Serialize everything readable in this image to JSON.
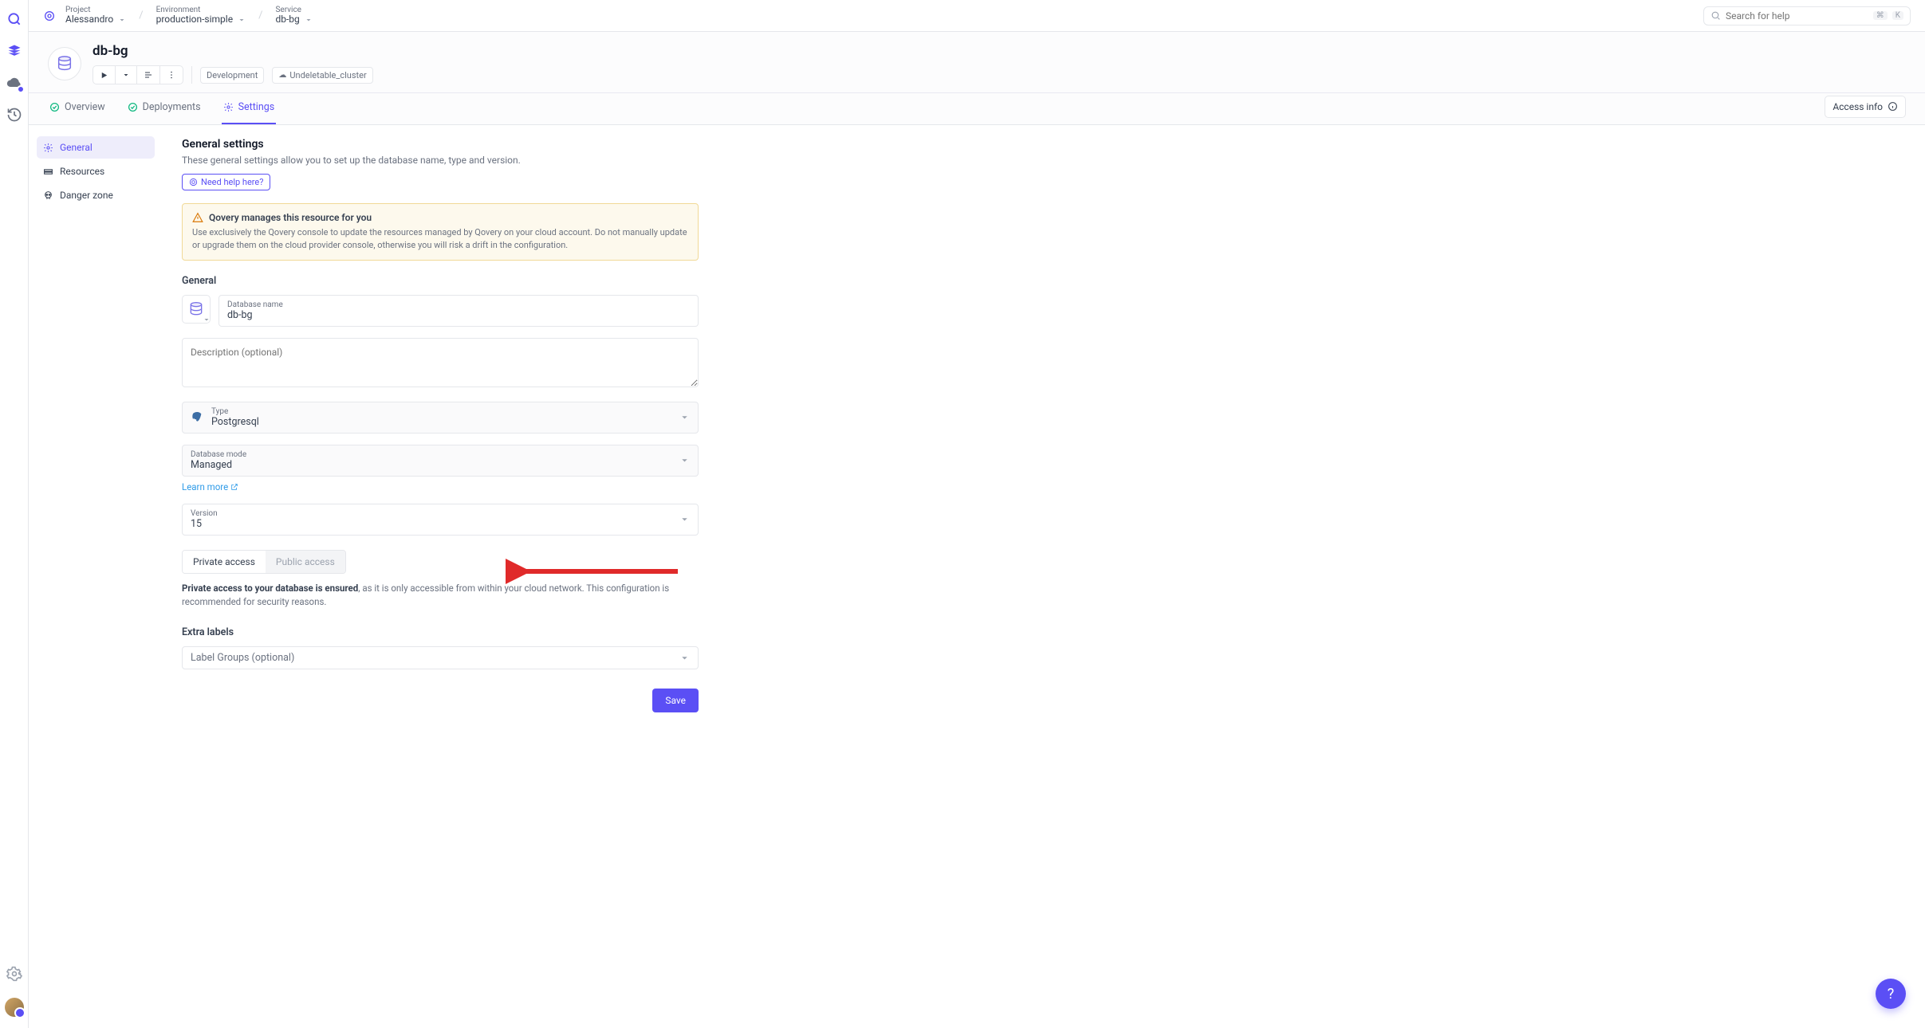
{
  "breadcrumb": {
    "project": {
      "label": "Project",
      "value": "Alessandro"
    },
    "environment": {
      "label": "Environment",
      "value": "production-simple"
    },
    "service": {
      "label": "Service",
      "value": "db-bg"
    }
  },
  "search": {
    "placeholder": "Search for help",
    "kbd1": "⌘",
    "kbd2": "K"
  },
  "header": {
    "title": "db-bg",
    "tag_dev": "Development",
    "tag_cluster": "Undeletable_cluster"
  },
  "tabs": {
    "overview": "Overview",
    "deployments": "Deployments",
    "settings": "Settings",
    "access": "Access info"
  },
  "sidebar": {
    "general": "General",
    "resources": "Resources",
    "danger": "Danger zone"
  },
  "page": {
    "title": "General settings",
    "subtitle": "These general settings allow you to set up the database name, type and version.",
    "help": "Need help here?",
    "alert_title": "Qovery manages this resource for you",
    "alert_body": "Use exclusively the Qovery console to update the resources managed by Qovery on your cloud account. Do not manually update or upgrade them on the cloud provider console, otherwise you will risk a drift in the configuration.",
    "section_general": "General",
    "db_name_label": "Database name",
    "db_name_value": "db-bg",
    "desc_placeholder": "Description (optional)",
    "type_label": "Type",
    "type_value": "Postgresql",
    "mode_label": "Database mode",
    "mode_value": "Managed",
    "learn_more": "Learn more",
    "version_label": "Version",
    "version_value": "15",
    "access_private": "Private access",
    "access_public": "Public access",
    "access_desc_b": "Private access to your database is ensured",
    "access_desc": ", as it is only accessible from within your cloud network. This configuration is recommended for security reasons.",
    "extra_labels": "Extra labels",
    "label_groups": "Label Groups (optional)",
    "save": "Save"
  }
}
